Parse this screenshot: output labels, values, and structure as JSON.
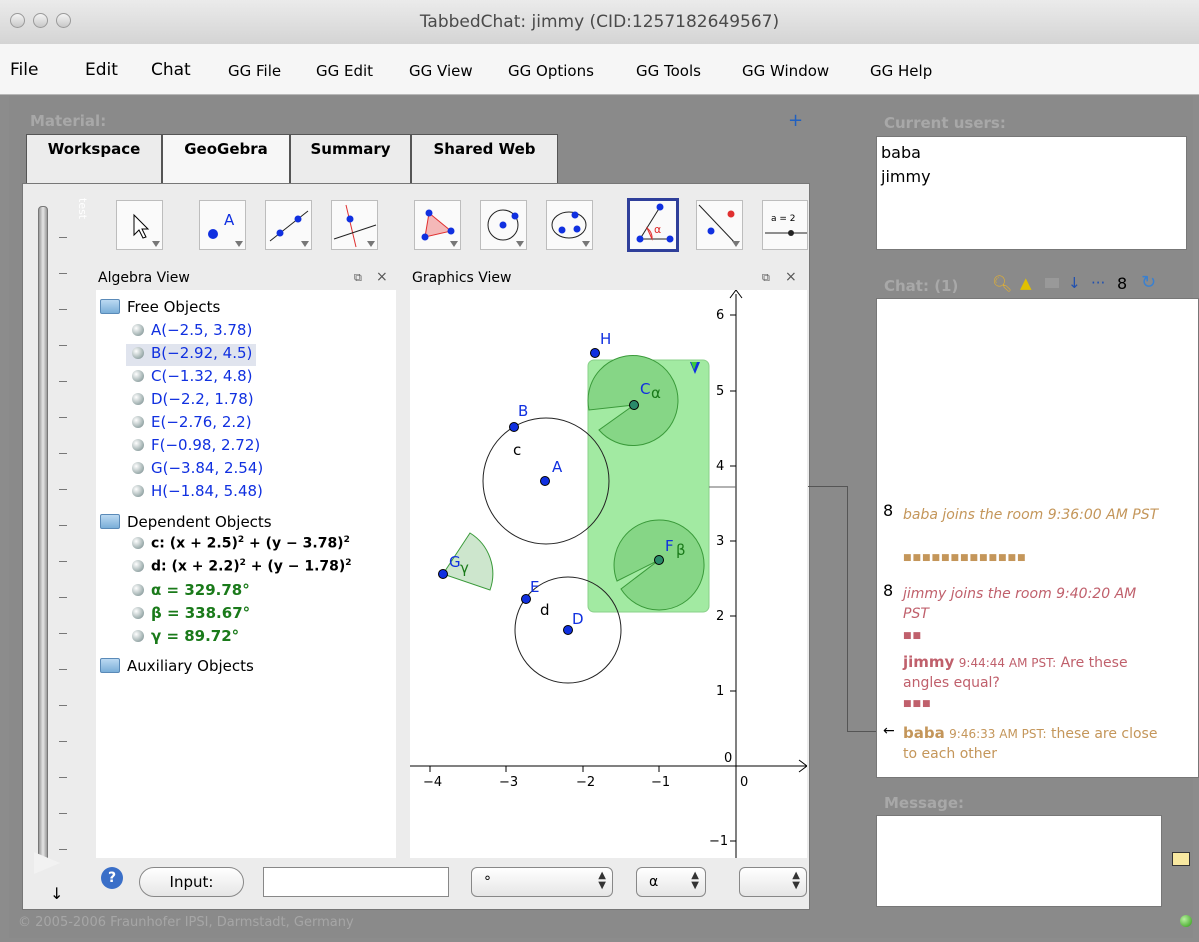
{
  "window": {
    "title": "TabbedChat: jimmy (CID:1257182649567)"
  },
  "menu": [
    "File",
    "Edit",
    "Chat",
    "GG File",
    "GG Edit",
    "GG View",
    "GG Options",
    "GG Tools",
    "GG Window",
    "GG Help"
  ],
  "material": {
    "label": "Material:",
    "add": "+"
  },
  "tabs": [
    "Workspace",
    "GeoGebra",
    "Summary",
    "Shared Web"
  ],
  "vertical_label": "test",
  "toolbar": {
    "last_tool_text": "a = 2"
  },
  "algebra": {
    "title": "Algebra View",
    "folders": {
      "free": "Free Objects",
      "dependent": "Dependent Objects",
      "aux": "Auxiliary Objects"
    },
    "free": [
      "A(−2.5, 3.78)",
      "B(−2.92, 4.5)",
      "C(−1.32, 4.8)",
      "D(−2.2, 1.78)",
      "E(−2.76, 2.2)",
      "F(−0.98, 2.72)",
      "G(−3.84, 2.54)",
      "H(−1.84, 5.48)"
    ],
    "dependent": [
      {
        "base": "c: (x + 2.5)",
        "mid": " + (y − 3.78)",
        "exp": "2"
      },
      {
        "base": "d: (x + 2.2)",
        "mid": " + (y − 1.78)",
        "exp": "2"
      }
    ],
    "angles": [
      "α = 329.78°",
      "β = 338.67°",
      "γ = 89.72°"
    ]
  },
  "graphics": {
    "title": "Graphics View",
    "xticks": [
      "−4",
      "−3",
      "−2",
      "−1",
      "0"
    ],
    "yticks": [
      "6",
      "5",
      "4",
      "3",
      "2",
      "1",
      "0",
      "−1"
    ],
    "labels": {
      "A": "A",
      "B": "B",
      "C": "C",
      "alpha": "α",
      "D": "D",
      "E": "E",
      "F": "F",
      "beta": "β",
      "G": "G",
      "gamma": "γ",
      "H": "H",
      "c": "c",
      "d": "d"
    }
  },
  "inputbar": {
    "input_label": "Input:",
    "degree": "°",
    "alpha": "α"
  },
  "footer": "© 2005-2006 Fraunhofer IPSI, Darmstadt, Germany",
  "users": {
    "label": "Current users:",
    "list": [
      "baba",
      "jimmy"
    ]
  },
  "chat": {
    "label": "Chat: (1)",
    "messages": [
      {
        "text": "baba joins the room 9:36:00 AM PST"
      },
      {
        "text": "jimmy joins the room 9:40:20 AM PST"
      },
      {
        "user": "jimmy",
        "time": "9:44:44 AM PST:",
        "text": "Are these angles equal?"
      },
      {
        "user": "baba",
        "time": "9:46:33 AM PST:",
        "text": "these are close to each other"
      }
    ]
  },
  "message": {
    "label": "Message:"
  },
  "colors": {
    "accent": "#2f3f9a",
    "region_fill": "#a2eaa2",
    "region_stroke": "#8ad08a",
    "brown": "#c4965a",
    "red": "#c0606c",
    "point_blue": "#1030e0"
  }
}
